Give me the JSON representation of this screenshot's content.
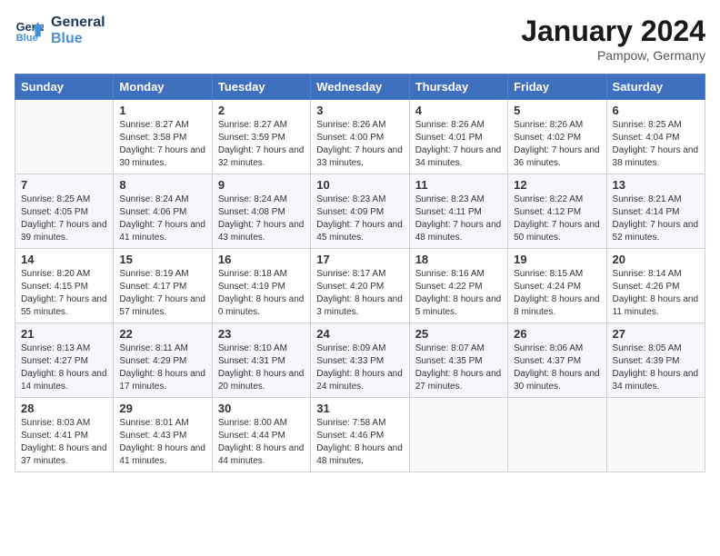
{
  "header": {
    "logo_line1": "General",
    "logo_line2": "Blue",
    "month_title": "January 2024",
    "location": "Pampow, Germany"
  },
  "days_of_week": [
    "Sunday",
    "Monday",
    "Tuesday",
    "Wednesday",
    "Thursday",
    "Friday",
    "Saturday"
  ],
  "weeks": [
    [
      {
        "day": "",
        "sunrise": "",
        "sunset": "",
        "daylight": ""
      },
      {
        "day": "1",
        "sunrise": "Sunrise: 8:27 AM",
        "sunset": "Sunset: 3:58 PM",
        "daylight": "Daylight: 7 hours and 30 minutes."
      },
      {
        "day": "2",
        "sunrise": "Sunrise: 8:27 AM",
        "sunset": "Sunset: 3:59 PM",
        "daylight": "Daylight: 7 hours and 32 minutes."
      },
      {
        "day": "3",
        "sunrise": "Sunrise: 8:26 AM",
        "sunset": "Sunset: 4:00 PM",
        "daylight": "Daylight: 7 hours and 33 minutes."
      },
      {
        "day": "4",
        "sunrise": "Sunrise: 8:26 AM",
        "sunset": "Sunset: 4:01 PM",
        "daylight": "Daylight: 7 hours and 34 minutes."
      },
      {
        "day": "5",
        "sunrise": "Sunrise: 8:26 AM",
        "sunset": "Sunset: 4:02 PM",
        "daylight": "Daylight: 7 hours and 36 minutes."
      },
      {
        "day": "6",
        "sunrise": "Sunrise: 8:25 AM",
        "sunset": "Sunset: 4:04 PM",
        "daylight": "Daylight: 7 hours and 38 minutes."
      }
    ],
    [
      {
        "day": "7",
        "sunrise": "Sunrise: 8:25 AM",
        "sunset": "Sunset: 4:05 PM",
        "daylight": "Daylight: 7 hours and 39 minutes."
      },
      {
        "day": "8",
        "sunrise": "Sunrise: 8:24 AM",
        "sunset": "Sunset: 4:06 PM",
        "daylight": "Daylight: 7 hours and 41 minutes."
      },
      {
        "day": "9",
        "sunrise": "Sunrise: 8:24 AM",
        "sunset": "Sunset: 4:08 PM",
        "daylight": "Daylight: 7 hours and 43 minutes."
      },
      {
        "day": "10",
        "sunrise": "Sunrise: 8:23 AM",
        "sunset": "Sunset: 4:09 PM",
        "daylight": "Daylight: 7 hours and 45 minutes."
      },
      {
        "day": "11",
        "sunrise": "Sunrise: 8:23 AM",
        "sunset": "Sunset: 4:11 PM",
        "daylight": "Daylight: 7 hours and 48 minutes."
      },
      {
        "day": "12",
        "sunrise": "Sunrise: 8:22 AM",
        "sunset": "Sunset: 4:12 PM",
        "daylight": "Daylight: 7 hours and 50 minutes."
      },
      {
        "day": "13",
        "sunrise": "Sunrise: 8:21 AM",
        "sunset": "Sunset: 4:14 PM",
        "daylight": "Daylight: 7 hours and 52 minutes."
      }
    ],
    [
      {
        "day": "14",
        "sunrise": "Sunrise: 8:20 AM",
        "sunset": "Sunset: 4:15 PM",
        "daylight": "Daylight: 7 hours and 55 minutes."
      },
      {
        "day": "15",
        "sunrise": "Sunrise: 8:19 AM",
        "sunset": "Sunset: 4:17 PM",
        "daylight": "Daylight: 7 hours and 57 minutes."
      },
      {
        "day": "16",
        "sunrise": "Sunrise: 8:18 AM",
        "sunset": "Sunset: 4:19 PM",
        "daylight": "Daylight: 8 hours and 0 minutes."
      },
      {
        "day": "17",
        "sunrise": "Sunrise: 8:17 AM",
        "sunset": "Sunset: 4:20 PM",
        "daylight": "Daylight: 8 hours and 3 minutes."
      },
      {
        "day": "18",
        "sunrise": "Sunrise: 8:16 AM",
        "sunset": "Sunset: 4:22 PM",
        "daylight": "Daylight: 8 hours and 5 minutes."
      },
      {
        "day": "19",
        "sunrise": "Sunrise: 8:15 AM",
        "sunset": "Sunset: 4:24 PM",
        "daylight": "Daylight: 8 hours and 8 minutes."
      },
      {
        "day": "20",
        "sunrise": "Sunrise: 8:14 AM",
        "sunset": "Sunset: 4:26 PM",
        "daylight": "Daylight: 8 hours and 11 minutes."
      }
    ],
    [
      {
        "day": "21",
        "sunrise": "Sunrise: 8:13 AM",
        "sunset": "Sunset: 4:27 PM",
        "daylight": "Daylight: 8 hours and 14 minutes."
      },
      {
        "day": "22",
        "sunrise": "Sunrise: 8:11 AM",
        "sunset": "Sunset: 4:29 PM",
        "daylight": "Daylight: 8 hours and 17 minutes."
      },
      {
        "day": "23",
        "sunrise": "Sunrise: 8:10 AM",
        "sunset": "Sunset: 4:31 PM",
        "daylight": "Daylight: 8 hours and 20 minutes."
      },
      {
        "day": "24",
        "sunrise": "Sunrise: 8:09 AM",
        "sunset": "Sunset: 4:33 PM",
        "daylight": "Daylight: 8 hours and 24 minutes."
      },
      {
        "day": "25",
        "sunrise": "Sunrise: 8:07 AM",
        "sunset": "Sunset: 4:35 PM",
        "daylight": "Daylight: 8 hours and 27 minutes."
      },
      {
        "day": "26",
        "sunrise": "Sunrise: 8:06 AM",
        "sunset": "Sunset: 4:37 PM",
        "daylight": "Daylight: 8 hours and 30 minutes."
      },
      {
        "day": "27",
        "sunrise": "Sunrise: 8:05 AM",
        "sunset": "Sunset: 4:39 PM",
        "daylight": "Daylight: 8 hours and 34 minutes."
      }
    ],
    [
      {
        "day": "28",
        "sunrise": "Sunrise: 8:03 AM",
        "sunset": "Sunset: 4:41 PM",
        "daylight": "Daylight: 8 hours and 37 minutes."
      },
      {
        "day": "29",
        "sunrise": "Sunrise: 8:01 AM",
        "sunset": "Sunset: 4:43 PM",
        "daylight": "Daylight: 8 hours and 41 minutes."
      },
      {
        "day": "30",
        "sunrise": "Sunrise: 8:00 AM",
        "sunset": "Sunset: 4:44 PM",
        "daylight": "Daylight: 8 hours and 44 minutes."
      },
      {
        "day": "31",
        "sunrise": "Sunrise: 7:58 AM",
        "sunset": "Sunset: 4:46 PM",
        "daylight": "Daylight: 8 hours and 48 minutes."
      },
      {
        "day": "",
        "sunrise": "",
        "sunset": "",
        "daylight": ""
      },
      {
        "day": "",
        "sunrise": "",
        "sunset": "",
        "daylight": ""
      },
      {
        "day": "",
        "sunrise": "",
        "sunset": "",
        "daylight": ""
      }
    ]
  ]
}
